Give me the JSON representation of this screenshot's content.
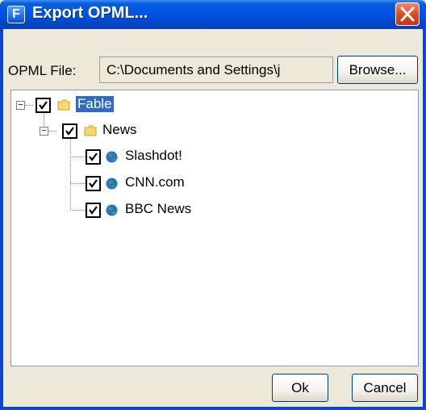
{
  "window": {
    "title": "Export OPML...",
    "app_icon_letter": "F",
    "close_icon": "close-icon"
  },
  "file_row": {
    "label": "OPML File:",
    "path_value": "C:\\Documents and Settings\\j",
    "browse_label": "Browse..."
  },
  "tree": {
    "root": {
      "label": "Fable",
      "checked": true,
      "expanded": true,
      "selected": true,
      "icon": "folder-icon"
    },
    "folder": {
      "label": "News",
      "checked": true,
      "expanded": true,
      "icon": "folder-icon"
    },
    "feeds": [
      {
        "label": "Slashdot!",
        "checked": true,
        "icon": "globe-icon"
      },
      {
        "label": "CNN.com",
        "checked": true,
        "icon": "globe-icon"
      },
      {
        "label": "BBC News",
        "checked": true,
        "icon": "globe-icon"
      }
    ]
  },
  "buttons": {
    "ok_label": "Ok",
    "cancel_label": "Cancel"
  },
  "colors": {
    "title_bar": "#0054e3",
    "selection": "#316ac5",
    "close_button": "#e0451f",
    "dialog_bg": "#ece9d8"
  }
}
